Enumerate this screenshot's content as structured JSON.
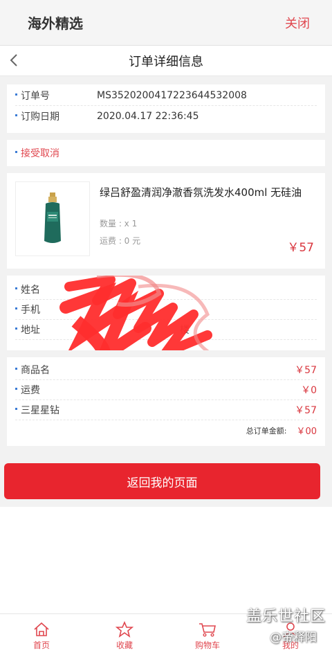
{
  "header": {
    "title": "海外精选",
    "close_label": "关闭"
  },
  "subheader": {
    "title": "订单详细信息"
  },
  "order": {
    "number_label": "订单号",
    "number_value": "MS352020041722364453​2008",
    "date_label": "订购日期",
    "date_value": "2020.04.17 22:36:45"
  },
  "status": {
    "label": "接受取消"
  },
  "product": {
    "name": "绿吕舒盈清润净澈香氛洗发水400ml 无硅油",
    "qty": "数量 : x 1",
    "shipping": "运费 : 0 元",
    "price": "￥57"
  },
  "recipient": {
    "name_label": "姓名",
    "phone_label": "手机",
    "address_label": "地址",
    "address_visible_fragment": "楼"
  },
  "summary": {
    "items": [
      {
        "label": "商品名",
        "value": "￥57"
      },
      {
        "label": "运费",
        "value": "￥0"
      },
      {
        "label": "三星星钻",
        "value": "￥57"
      }
    ],
    "total_label": "总订单金额:",
    "total_value": "￥00"
  },
  "actions": {
    "return_label": "返回我的页面"
  },
  "watermark": {
    "line1": "盖乐世社区",
    "line2": "@帝释阳"
  },
  "nav": [
    {
      "label": "首页",
      "icon": "home-icon"
    },
    {
      "label": "收藏",
      "icon": "star-icon"
    },
    {
      "label": "购物车",
      "icon": "cart-icon"
    },
    {
      "label": "我的",
      "icon": "user-icon"
    }
  ],
  "colors": {
    "accent": "#e0474f",
    "button": "#e8252e",
    "bullet": "#3a7bd5"
  }
}
